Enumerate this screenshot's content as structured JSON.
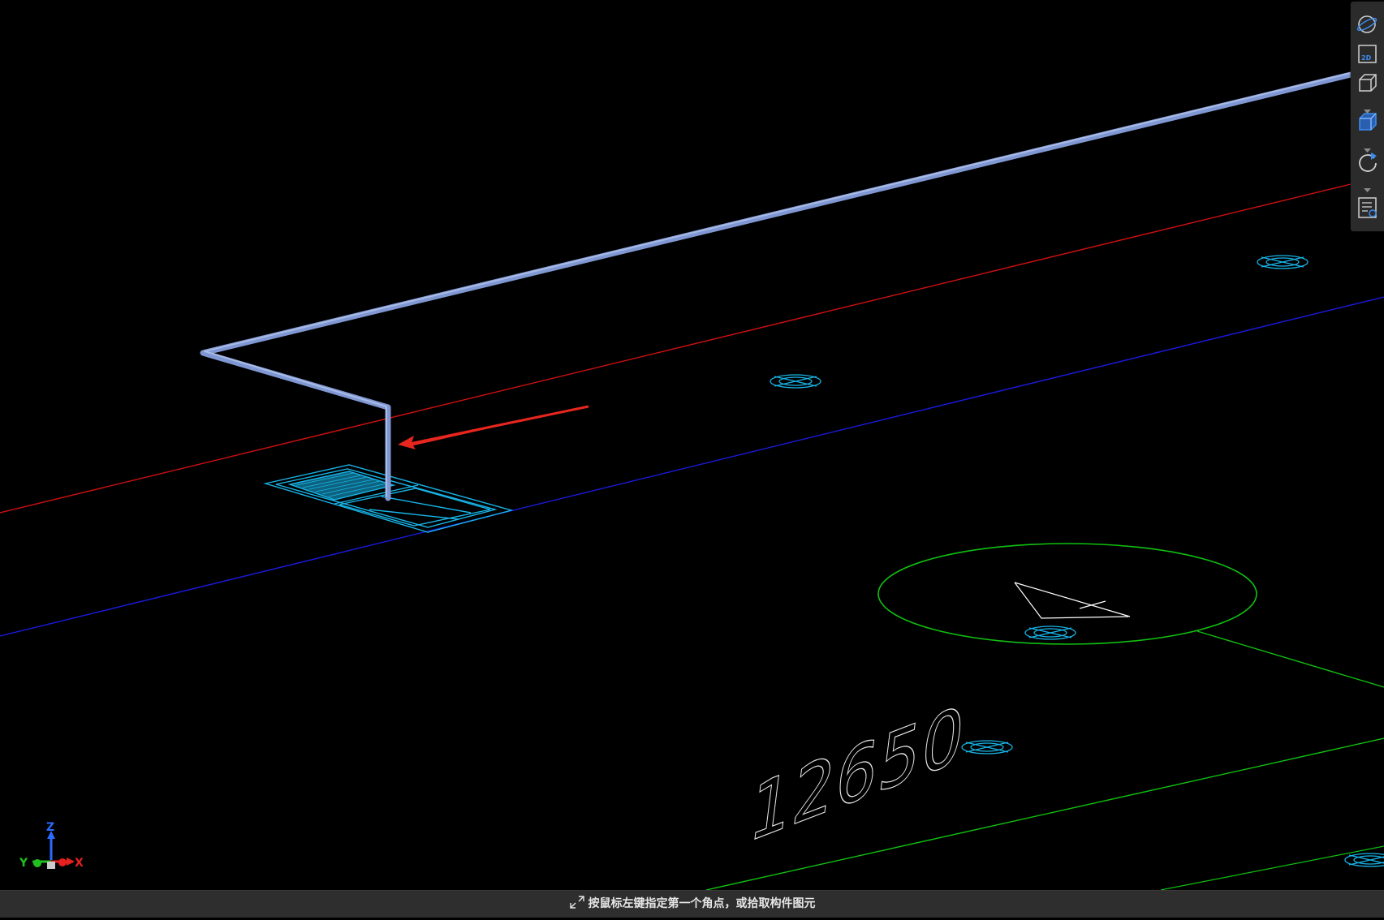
{
  "viewport": {
    "dimension_text": "12650",
    "axis_labels": {
      "x": "X",
      "y": "Y",
      "z": "Z"
    },
    "colors": {
      "pipe": "#7f97d2",
      "red_line": "#d01010",
      "blue_line": "#1a1ae0",
      "green_line": "#10c010",
      "cyan_symbol": "#18b4e8",
      "arrow": "#e8261e",
      "background": "#000000"
    }
  },
  "toolbar": {
    "buttons": [
      {
        "icon": "orbit-sphere-icon"
      },
      {
        "icon": "2d-view-icon",
        "label": "2D"
      },
      {
        "icon": "wireframe-cube-icon"
      },
      {
        "icon": "shaded-cube-icon"
      },
      {
        "icon": "rotate-icon"
      },
      {
        "icon": "properties-panel-icon"
      }
    ]
  },
  "statusbar": {
    "message": "按鼠标左键指定第一个角点，或拾取构件图元",
    "icon": "corner-select-icon"
  }
}
